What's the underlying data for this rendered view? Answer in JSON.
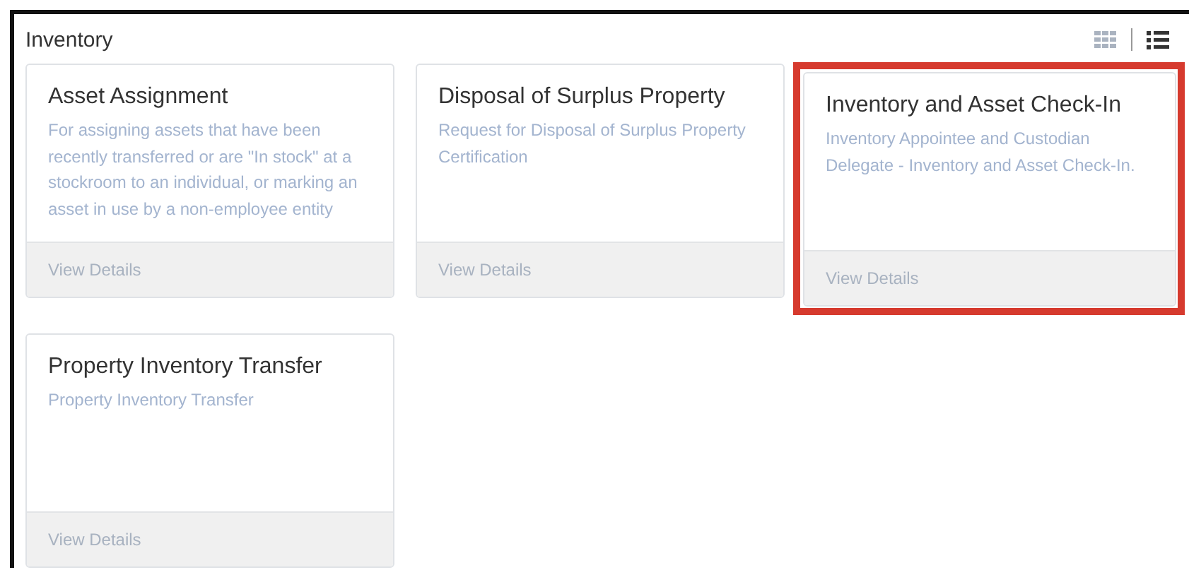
{
  "section": {
    "title": "Inventory"
  },
  "view_toggle": [
    {
      "kind": "grid",
      "selected": false
    },
    {
      "kind": "list",
      "selected": true
    }
  ],
  "cards": [
    {
      "title": "Asset Assignment",
      "description": "For assigning assets that have been recently transferred or are \"In stock\" at a stockroom to an individual, or marking an asset in use by a non-employee entity",
      "action": "View Details",
      "highlighted": false
    },
    {
      "title": "Disposal of Surplus Property",
      "description": "Request for Disposal of Surplus Property Certification",
      "action": "View Details",
      "highlighted": false
    },
    {
      "title": "Inventory and Asset Check-In",
      "description": "Inventory Appointee and Custodian Delegate - Inventory and Asset Check-In.",
      "action": "View Details",
      "highlighted": true
    },
    {
      "title": "Property Inventory Transfer",
      "description": "Property Inventory Transfer",
      "action": "View Details",
      "highlighted": false
    }
  ]
}
